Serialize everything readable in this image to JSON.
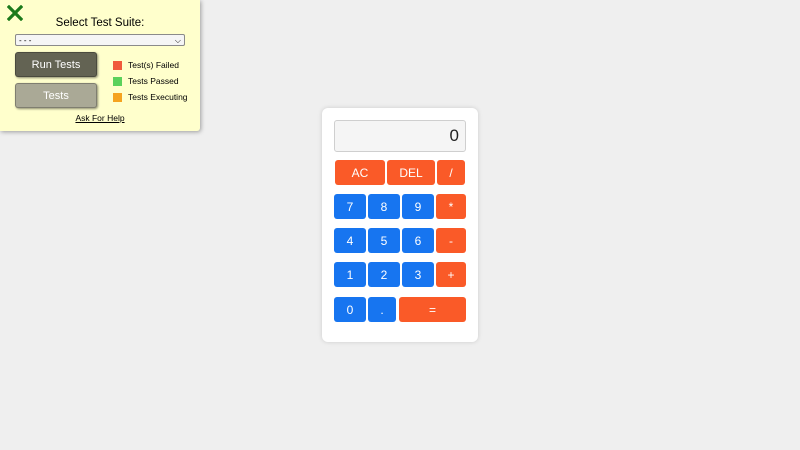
{
  "test_panel": {
    "title": "Select Test Suite:",
    "select_value": "- - -",
    "run_label": "Run Tests",
    "tests_label": "Tests",
    "legend": [
      {
        "label": "Test(s) Failed",
        "color": "#f05a3c"
      },
      {
        "label": "Tests Passed",
        "color": "#5bd15b"
      },
      {
        "label": "Tests Executing",
        "color": "#f5a31e"
      }
    ],
    "help_label": "Ask For Help",
    "close_icon_color": "#1b7a1b"
  },
  "calculator": {
    "display": "0",
    "keys": {
      "ac": "AC",
      "del": "DEL",
      "divide": "/",
      "seven": "7",
      "eight": "8",
      "nine": "9",
      "multiply": "*",
      "four": "4",
      "five": "5",
      "six": "6",
      "minus": "-",
      "one": "1",
      "two": "2",
      "three": "3",
      "plus": "+",
      "zero": "0",
      "dot": ".",
      "equals": "="
    },
    "colors": {
      "number": "#1775f0",
      "operator": "#fa5a28"
    }
  }
}
